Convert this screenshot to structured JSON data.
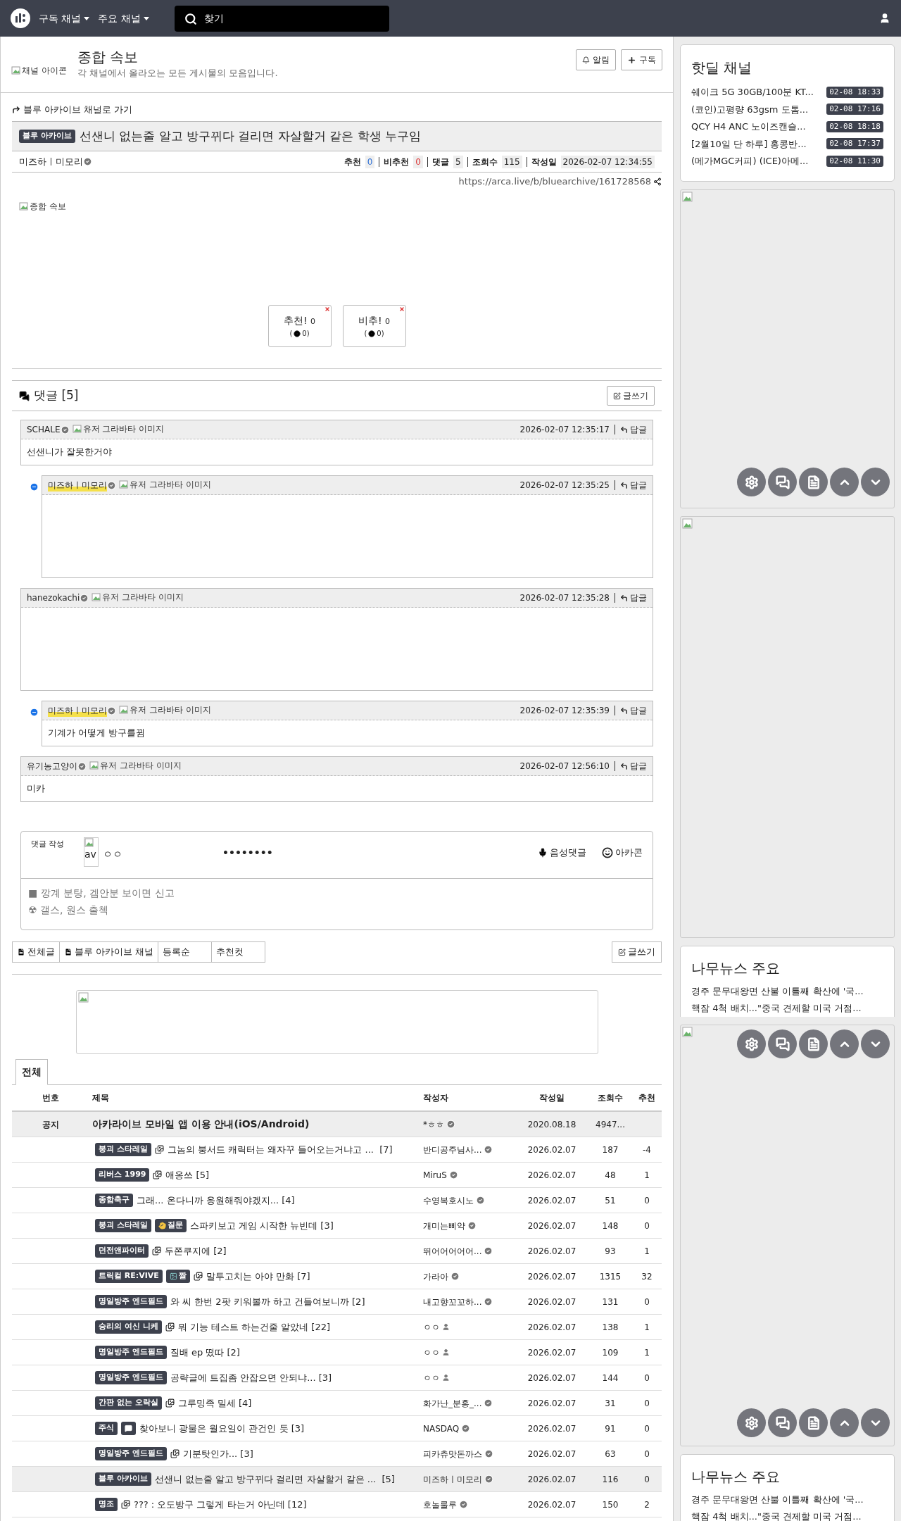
{
  "nav": {
    "menus": [
      "구독 채널",
      "주요 채널"
    ],
    "search": {
      "placeholder": "찾기"
    }
  },
  "channel": {
    "icon_alt": "채널 아이콘",
    "title": "종합 속보",
    "description": "각 채널에서 올라오는 모든 게시물의 모음입니다.",
    "buttons": [
      "알림",
      "구독"
    ]
  },
  "post": {
    "back_link": "블루 아카이브 채널로 가기",
    "category": "블루 아카이브",
    "title": "선샌니 없는줄 알고 방구뀌다 걸리면 자살할거 같은 학생 누구임",
    "author": "미즈하ㅣ미모리",
    "stats": [
      {
        "kind": "up",
        "label": "추천",
        "value": "0"
      },
      {
        "kind": "down",
        "label": "비추천",
        "value": "0"
      },
      {
        "kind": "plain",
        "label": "댓글",
        "value": "5"
      },
      {
        "kind": "plain",
        "label": "조회수",
        "value": "115"
      },
      {
        "kind": "plain",
        "label": "작성일",
        "value": "2026-02-07 12:34:55"
      }
    ],
    "url": "https://arca.live/b/bluearchive/161728568",
    "image_alt": "종합 속보",
    "votes": [
      {
        "label": "추천!",
        "count": "0",
        "open": "(",
        "sub": "0)"
      },
      {
        "label": "비추!",
        "count": "0",
        "open": "(",
        "sub": "0)"
      }
    ]
  },
  "comments": {
    "title": "댓글 [5]",
    "write_button": "글쓰기",
    "items": [
      {
        "author": "SCHALE",
        "reply": false,
        "by_op": false,
        "avatar_alt": "유저 그라바타 이미지",
        "time": "2026-02-07 12:35:17",
        "reply_label": "답글",
        "kind": "text",
        "body": "선샌니가 잘못한거야"
      },
      {
        "author": "미즈하ㅣ미모리",
        "reply": true,
        "by_op": true,
        "avatar_alt": "유저 그라바타 이미지",
        "time": "2026-02-07 12:35:25",
        "reply_label": "답글",
        "kind": "blank"
      },
      {
        "author": "hanezokachi",
        "reply": false,
        "by_op": false,
        "avatar_alt": "유저 그라바타 이미지",
        "time": "2026-02-07 12:35:28",
        "reply_label": "답글",
        "kind": "blank"
      },
      {
        "author": "미즈하ㅣ미모리",
        "reply": true,
        "by_op": true,
        "avatar_alt": "유저 그라바타 이미지",
        "time": "2026-02-07 12:35:39",
        "reply_label": "답글",
        "kind": "text",
        "body": "기계가 어떻게 방구를뀜"
      },
      {
        "author": "유기농고양이",
        "reply": false,
        "by_op": false,
        "avatar_alt": "유저 그라바타 이미지",
        "time": "2026-02-07 12:56:10",
        "reply_label": "답글",
        "kind": "text",
        "body": "미카"
      }
    ]
  },
  "comment_form": {
    "label": "댓글 작성",
    "avatar_alt": "av",
    "name": "ㅇㅇ",
    "password": "••••••••",
    "buttons": [
      "음성댓글",
      "아카콘"
    ],
    "placeholder": "■ 깡계 분탕, 겜안분 보이면 신고\n☢ 갤스, 원스 출첵"
  },
  "board_tabs": [
    {
      "label": "전체글",
      "icon": true
    },
    {
      "label": "블루 아카이브 채널",
      "icon": true
    },
    {
      "label": "등록순",
      "icon": false
    },
    {
      "label": "추천컷",
      "icon": false
    }
  ],
  "write_button": "글쓰기",
  "list_tabs": [
    {
      "label": "전체",
      "selected": true
    }
  ],
  "table": {
    "columns": [
      "번호",
      "제목",
      "작성자",
      "작성일",
      "조회수",
      "추천"
    ],
    "notice": {
      "number": "공지",
      "title": "아카라이브 모바일 앱 이용 안내(iOS/Android)",
      "author": "*ㅎㅎ",
      "date": "2020.08.18",
      "views": "4947..."
    },
    "rows": [
      {
        "tags": [
          {
            "text": "붕괴 스타레일"
          }
        ],
        "has_image": true,
        "title": "그놈의 붕서드 캐릭터는 왜자꾸 들어오는거냐고 ...  [7]",
        "author": "반디공주님사...",
        "kind": "verified",
        "date": "2026.02.07",
        "views": "187",
        "votes": "-4",
        "selected": false
      },
      {
        "tags": [
          {
            "text": "리버스 1999"
          }
        ],
        "has_image": true,
        "title": "애옹쓰 [5]",
        "author": "MiruS",
        "kind": "verified",
        "date": "2026.02.07",
        "views": "48",
        "votes": "1",
        "selected": false
      },
      {
        "tags": [
          {
            "text": "종합축구"
          }
        ],
        "has_image": false,
        "title": "그래... 온다니까 응원해줘야겠지... [4]",
        "author": "수영복호시노",
        "kind": "verified",
        "date": "2026.02.07",
        "views": "51",
        "votes": "0",
        "selected": false
      },
      {
        "tags": [
          {
            "text": "붕괴 스타레일"
          },
          {
            "kind": "question",
            "text": "질문"
          }
        ],
        "has_image": false,
        "title": "스파키보고 게임 시작한 뉴빈데 [3]",
        "author": "개미는삐약",
        "kind": "verified",
        "date": "2026.02.07",
        "views": "148",
        "votes": "0",
        "selected": false
      },
      {
        "tags": [
          {
            "text": "던전앤파이터"
          }
        ],
        "has_image": true,
        "title": "두쫀쿠지에 [2]",
        "author": "뛰어어어어어...",
        "kind": "verified",
        "date": "2026.02.07",
        "views": "93",
        "votes": "1",
        "selected": false
      },
      {
        "tags": [
          {
            "text": "트릭컬 RE:VIVE"
          },
          {
            "kind": "meme",
            "text": "짤"
          }
        ],
        "has_image": true,
        "title": "말투고치는 아야 만화 [7]",
        "author": "가라아",
        "kind": "verified",
        "date": "2026.02.07",
        "views": "1315",
        "votes": "32",
        "selected": false
      },
      {
        "tags": [
          {
            "text": "명일방주 엔드필드"
          }
        ],
        "has_image": false,
        "title": "와 씨 한번 2팟 키워볼까 하고 건들여보니까 [2]",
        "author": "내고향꼬꼬하...",
        "kind": "verified",
        "date": "2026.02.07",
        "views": "131",
        "votes": "0",
        "selected": false
      },
      {
        "tags": [
          {
            "text": "승리의 여신 니케"
          }
        ],
        "has_image": true,
        "title": "뭐 기능 테스트 하는건줄 알았네 [22]",
        "author": "ㅇㅇ",
        "kind": "member",
        "date": "2026.02.07",
        "views": "138",
        "votes": "1",
        "selected": false
      },
      {
        "tags": [
          {
            "text": "명일방주 엔드필드"
          }
        ],
        "has_image": false,
        "title": "질배 ep 떴따 [2]",
        "author": "ㅇㅇ",
        "kind": "member",
        "date": "2026.02.07",
        "views": "109",
        "votes": "1",
        "selected": false
      },
      {
        "tags": [
          {
            "text": "명일방주 엔드필드"
          }
        ],
        "has_image": false,
        "title": "공략글에 트집좀 안잡으면 안되냐... [3]",
        "author": "ㅇㅇ",
        "kind": "member",
        "date": "2026.02.07",
        "views": "144",
        "votes": "0",
        "selected": false
      },
      {
        "tags": [
          {
            "text": "간판 없는 오락실"
          }
        ],
        "has_image": true,
        "title": "그루밍족 밀세 [4]",
        "author": "화가난_분홍_...",
        "kind": "verified",
        "date": "2026.02.07",
        "views": "31",
        "votes": "0",
        "selected": false
      },
      {
        "tags": [
          {
            "text": "주식"
          },
          {
            "kind": "chat"
          }
        ],
        "has_image": false,
        "title": "찾아보니 광물은 월요일이 관건인 듯 [3]",
        "author": "NASDAQ",
        "kind": "verified",
        "date": "2026.02.07",
        "views": "91",
        "votes": "0",
        "selected": false
      },
      {
        "tags": [
          {
            "text": "명일방주 엔드필드"
          }
        ],
        "has_image": true,
        "title": "기분탓인가... [3]",
        "author": "피카츄맛돈까스",
        "kind": "verified",
        "date": "2026.02.07",
        "views": "63",
        "votes": "0",
        "selected": false
      },
      {
        "tags": [
          {
            "text": "블루 아카이브"
          }
        ],
        "has_image": false,
        "title": "선샌니 없는줄 알고 방구뀌다 걸리면 자살할거 같은 ...  [5]",
        "author": "미즈하ㅣ미모리",
        "kind": "verified",
        "date": "2026.02.07",
        "views": "116",
        "votes": "0",
        "selected": true
      },
      {
        "tags": [
          {
            "text": "명조"
          }
        ],
        "has_image": true,
        "title": "??? : 오도방구 그렇게 타는거 아닌데 [12]",
        "author": "호놀룰루",
        "kind": "verified",
        "date": "2026.02.07",
        "views": "150",
        "votes": "2",
        "selected": false
      }
    ]
  },
  "sidebar": [
    {
      "kind": "deals",
      "title": "핫딜 채널",
      "items": [
        {
          "title": "쉐이크 5G 30GB/100분 KT...",
          "time": "02-08 18:33"
        },
        {
          "title": "(코인)고평량 63gsm 도톰...",
          "time": "02-08 17:16"
        },
        {
          "title": "QCY H4 ANC 노이즈캔슬...",
          "time": "02-08 18:18"
        },
        {
          "title": "[2월10일 단 하루] 홍콩반...",
          "time": "02-08 17:37"
        },
        {
          "title": "(메가MGC커피) (ICE)아메...",
          "time": "02-08 11:30"
        }
      ]
    },
    {
      "kind": "short_ad"
    },
    {
      "kind": "tall_ad"
    },
    {
      "kind": "news",
      "title": "나무뉴스 주요",
      "lines": [
        "경주 문무대왕면 산불 이틀째 확산에 '국...",
        "핵잠 4척 배치...\"중국 견제할 미국 거점..."
      ]
    },
    {
      "kind": "tall_ad"
    },
    {
      "kind": "news",
      "title": "나무뉴스 주요",
      "lines": [
        "경주 문무대왕면 산불 이틀째 확산에 '국...",
        "핵잠 4척 배치...\"중국 견제할 미국 거점..."
      ]
    }
  ]
}
